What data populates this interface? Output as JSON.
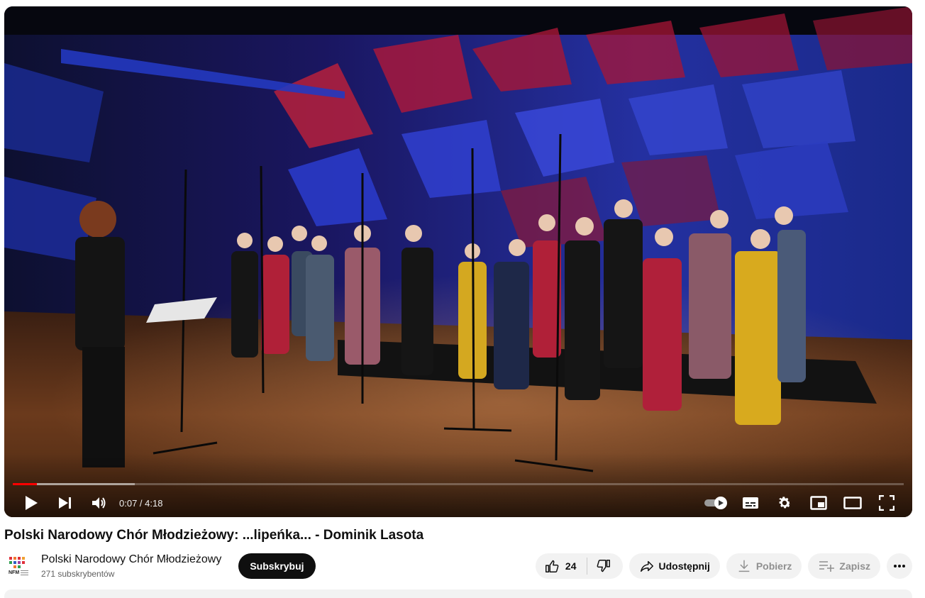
{
  "player": {
    "time_display": "0:07 / 4:18",
    "progress_played_fraction": 0.027,
    "progress_buffered_fraction": 0.137,
    "autoplay_on": true,
    "accent_color": "#ff0000",
    "icons": [
      "play-icon",
      "next-icon",
      "volume-icon",
      "autoplay-toggle-icon",
      "subtitles-icon",
      "settings-gear-icon",
      "miniplayer-icon",
      "theater-mode-icon",
      "fullscreen-icon"
    ]
  },
  "video": {
    "title": "Polski Narodowy Chór Młodzieżowy: ...lipeńka... - Dominik Lasota"
  },
  "channel": {
    "name": "Polski Narodowy Chór Młodzieżowy",
    "subscribers": "271 subskrybentów",
    "logo_text": "NFM",
    "subscribe_label": "Subskrybuj"
  },
  "actions": {
    "like_count": "24",
    "share_label": "Udostępnij",
    "download_label": "Pobierz",
    "save_label": "Zapisz",
    "icons": [
      "thumbs-up-icon",
      "thumbs-down-icon",
      "share-arrow-icon",
      "download-icon",
      "playlist-add-icon",
      "more-dots-icon"
    ]
  }
}
